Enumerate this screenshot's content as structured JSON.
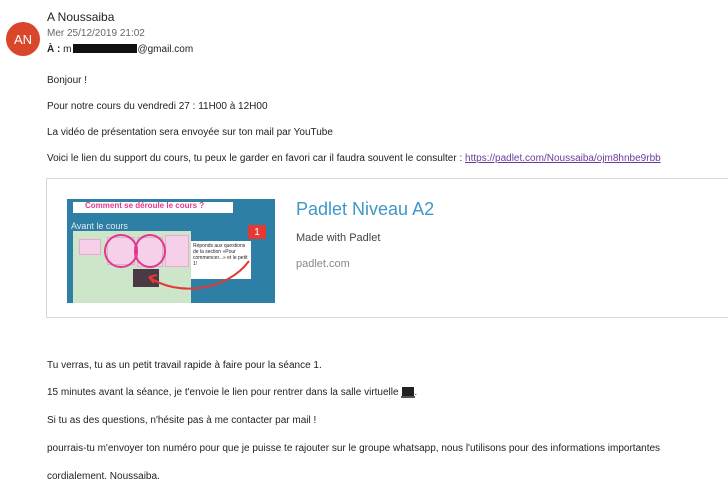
{
  "avatar": {
    "initials": "AN",
    "color": "#d9462a"
  },
  "header": {
    "sender": "A Noussaiba",
    "date": "Mer 25/12/2019 21:02",
    "to_label": "À :",
    "to_prefix": "m",
    "to_suffix": "@gmail.com"
  },
  "body": {
    "greeting": "Bonjour !",
    "line1": "Pour notre cours du vendredi 27 : 11H00 à 12H00",
    "line2": "La vidéo de présentation sera envoyée sur ton mail par YouTube",
    "line3_text": "Voici le lien du support du cours, tu peux le garder en favori car il faudra souvent le consulter : ",
    "line3_link": "https://padlet.com/Noussaiba/ojm8hnbe9rbb",
    "line4": "Tu verras, tu as un petit travail rapide à faire pour la séance 1.",
    "line5": "15 minutes avant la séance, je t'envoie le lien pour rentrer dans la salle virtuelle",
    "line5_end": ".",
    "line6": "Si tu as des questions, n'hésite pas à me contacter par mail !",
    "line7": "pourrais-tu m'envoyer ton numéro pour que je puisse te rajouter sur le groupe whatsapp, nous l'utilisons pour des informations importantes",
    "signature": "cordialement. Noussaiba."
  },
  "card": {
    "title": "Padlet Niveau A2",
    "description": "Made with Padlet",
    "domain": "padlet.com",
    "thumb": {
      "heading": "Comment se déroule le cours ?",
      "subheading": "Avant le cours",
      "badge": "1",
      "note_text": "Réponds aux questions de la section «Pour commencer...» et le petit 1!"
    },
    "title_color": "#3e97c7"
  },
  "colors": {
    "link": "#6b3a9c",
    "padlet_bg": "#2d7fa6"
  }
}
